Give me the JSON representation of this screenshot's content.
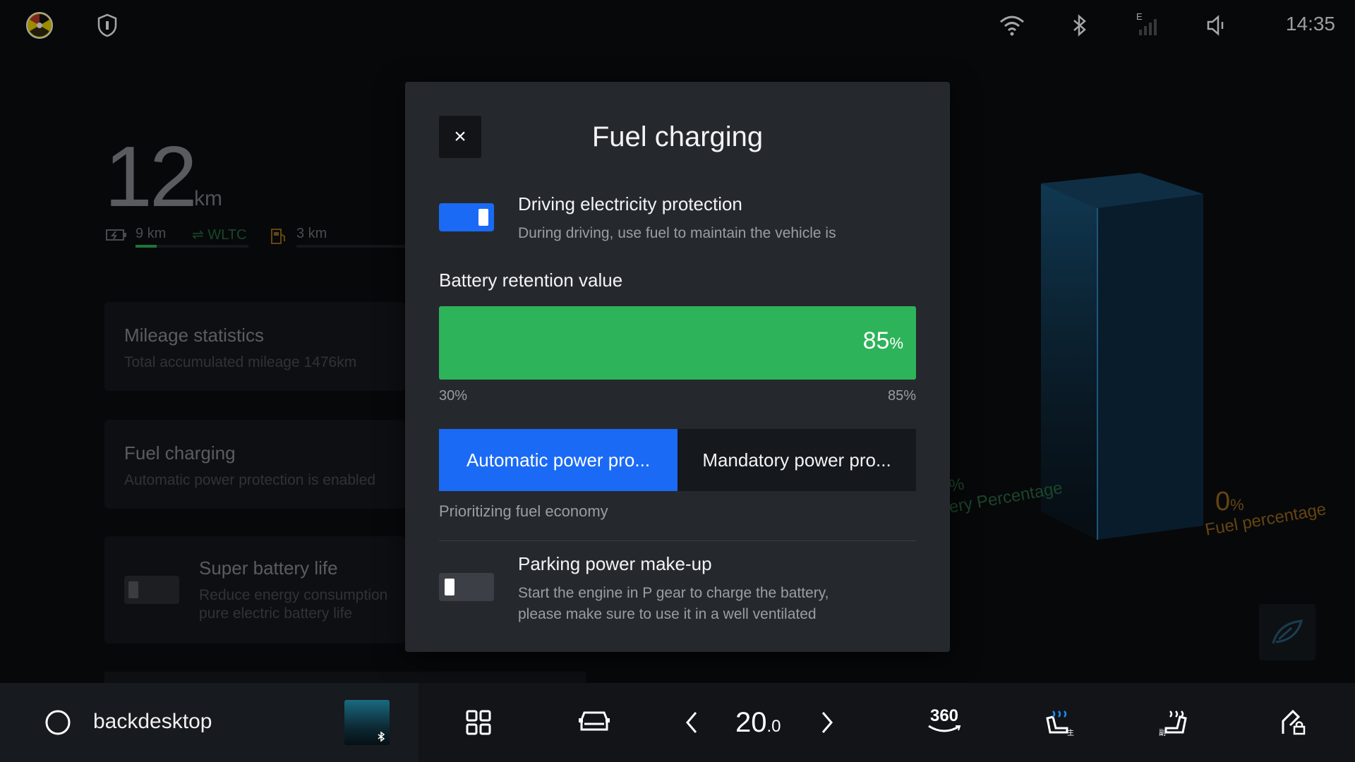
{
  "status_bar": {
    "time": "14:35",
    "signal_label": "E",
    "icons": [
      "app-logo-icon",
      "shield-icon",
      "wifi-icon",
      "bluetooth-icon",
      "signal-icon",
      "volume-icon"
    ]
  },
  "background": {
    "range_value": "12",
    "range_unit": "km",
    "electric_range": "9 km",
    "standard": "⇌ WLTC",
    "fuel_range": "3 km",
    "cards": [
      {
        "title": "Mileage statistics",
        "subtitle": "Total accumulated mileage 1476km"
      },
      {
        "title": "Fuel charging",
        "subtitle": "Automatic power protection is enabled"
      },
      {
        "title": "Super battery life",
        "subtitle_line1": "Reduce energy consumption",
        "subtitle_line2": "pure electric battery life"
      }
    ],
    "battery_pct_label": "%",
    "battery_percentage_label": "ery Percentage",
    "fuel_pct_value": "0",
    "fuel_pct_unit": "%",
    "fuel_percentage_label": "Fuel percentage"
  },
  "modal": {
    "title": "Fuel charging",
    "close_label": "×",
    "driving_protection": {
      "title": "Driving electricity protection",
      "description": "During driving, use fuel to maintain the vehicle is",
      "enabled": true
    },
    "battery_retention": {
      "label": "Battery retention value",
      "value_text": "85",
      "unit": "%",
      "min_label": "30%",
      "max_label": "85%",
      "min": 30,
      "max": 85,
      "value": 85
    },
    "modes": {
      "options": [
        "Automatic power pro...",
        "Mandatory power pro..."
      ],
      "selected_index": 0,
      "description": "Prioritizing fuel economy"
    },
    "parking_makeup": {
      "title": "Parking power make-up",
      "description_line1": "Start the engine in P gear to charge the battery,",
      "description_line2": "please make sure to use it in a well ventilated",
      "enabled": false
    }
  },
  "bottom_bar": {
    "home_label": "backdesktop",
    "temperature_int": "20",
    "temperature_dec": ".0",
    "camera_label": "360"
  },
  "colors": {
    "accent_blue": "#1a6af5",
    "slider_green": "#2db35a",
    "modal_bg": "#25292e"
  }
}
